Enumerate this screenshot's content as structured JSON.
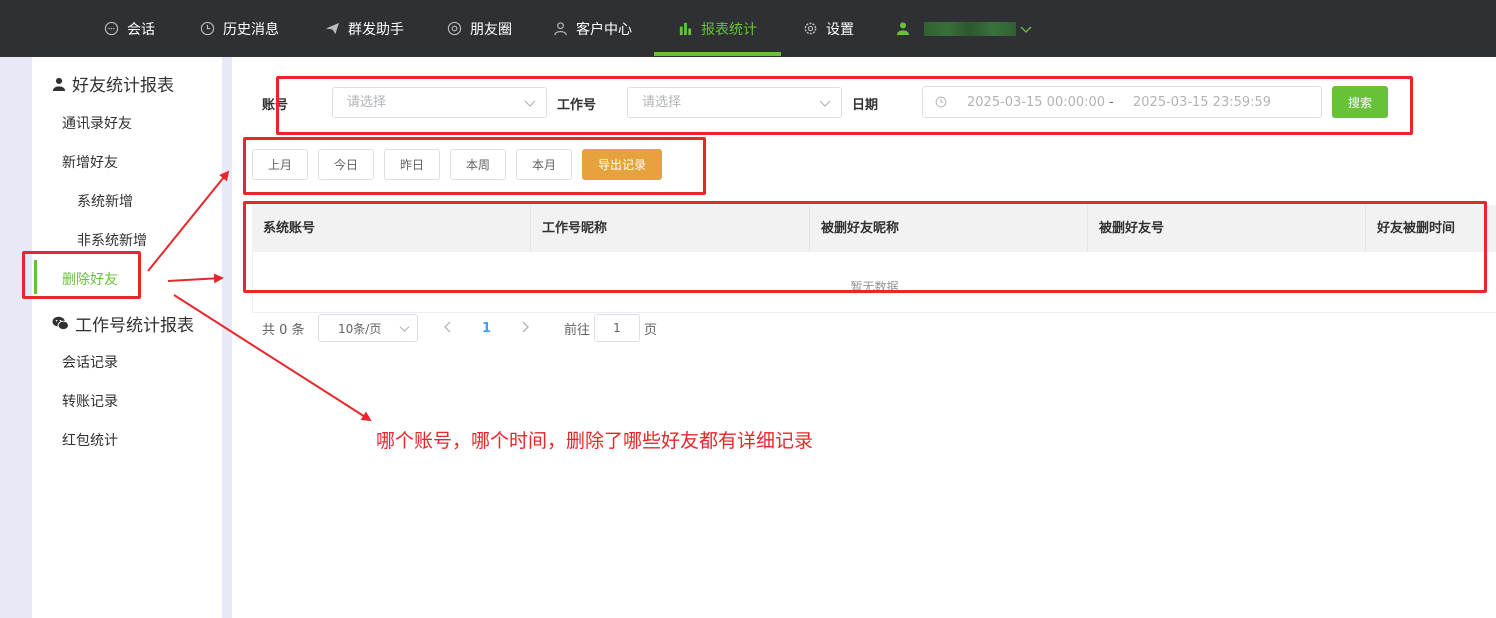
{
  "nav": {
    "items": [
      {
        "label": "会话",
        "icon": "chat-icon"
      },
      {
        "label": "历史消息",
        "icon": "clock-icon"
      },
      {
        "label": "群发助手",
        "icon": "send-icon"
      },
      {
        "label": "朋友圈",
        "icon": "aperture-icon"
      },
      {
        "label": "客户中心",
        "icon": "user-icon"
      },
      {
        "label": "报表统计",
        "icon": "bar-chart-icon",
        "active": true
      },
      {
        "label": "设置",
        "icon": "gear-icon"
      }
    ],
    "accent": "#67c23a"
  },
  "sidebar": {
    "group1": "好友统计报表",
    "items1": [
      "通讯录好友",
      "新增好友",
      "系统新增",
      "非系统新增",
      "删除好友"
    ],
    "group2": "工作号统计报表",
    "items2": [
      "会话记录",
      "转账记录",
      "红包统计"
    ]
  },
  "filters": {
    "account_label": "账号",
    "account_placeholder": "请选择",
    "worker_label": "工作号",
    "worker_placeholder": "请选择",
    "date_label": "日期",
    "date_start": "2025-03-15 00:00:00",
    "date_sep": "-",
    "date_end": "2025-03-15 23:59:59",
    "search": "搜索"
  },
  "quick": [
    "上月",
    "今日",
    "昨日",
    "本周",
    "本月"
  ],
  "export": "导出记录",
  "table": {
    "columns": [
      "系统账号",
      "工作号昵称",
      "被删好友昵称",
      "被删好友号",
      "好友被删时间"
    ],
    "empty": "暂无数据"
  },
  "pager": {
    "total": "共 0 条",
    "size": "10条/页",
    "current": "1",
    "goto": "前往",
    "goto_value": "1",
    "page_unit": "页"
  },
  "annotation": "哪个账号，哪个时间，删除了哪些好友都有详细记录",
  "colors": {
    "annotation": "#e9262a",
    "export": "#e6a23c",
    "search": "#67c23a"
  }
}
